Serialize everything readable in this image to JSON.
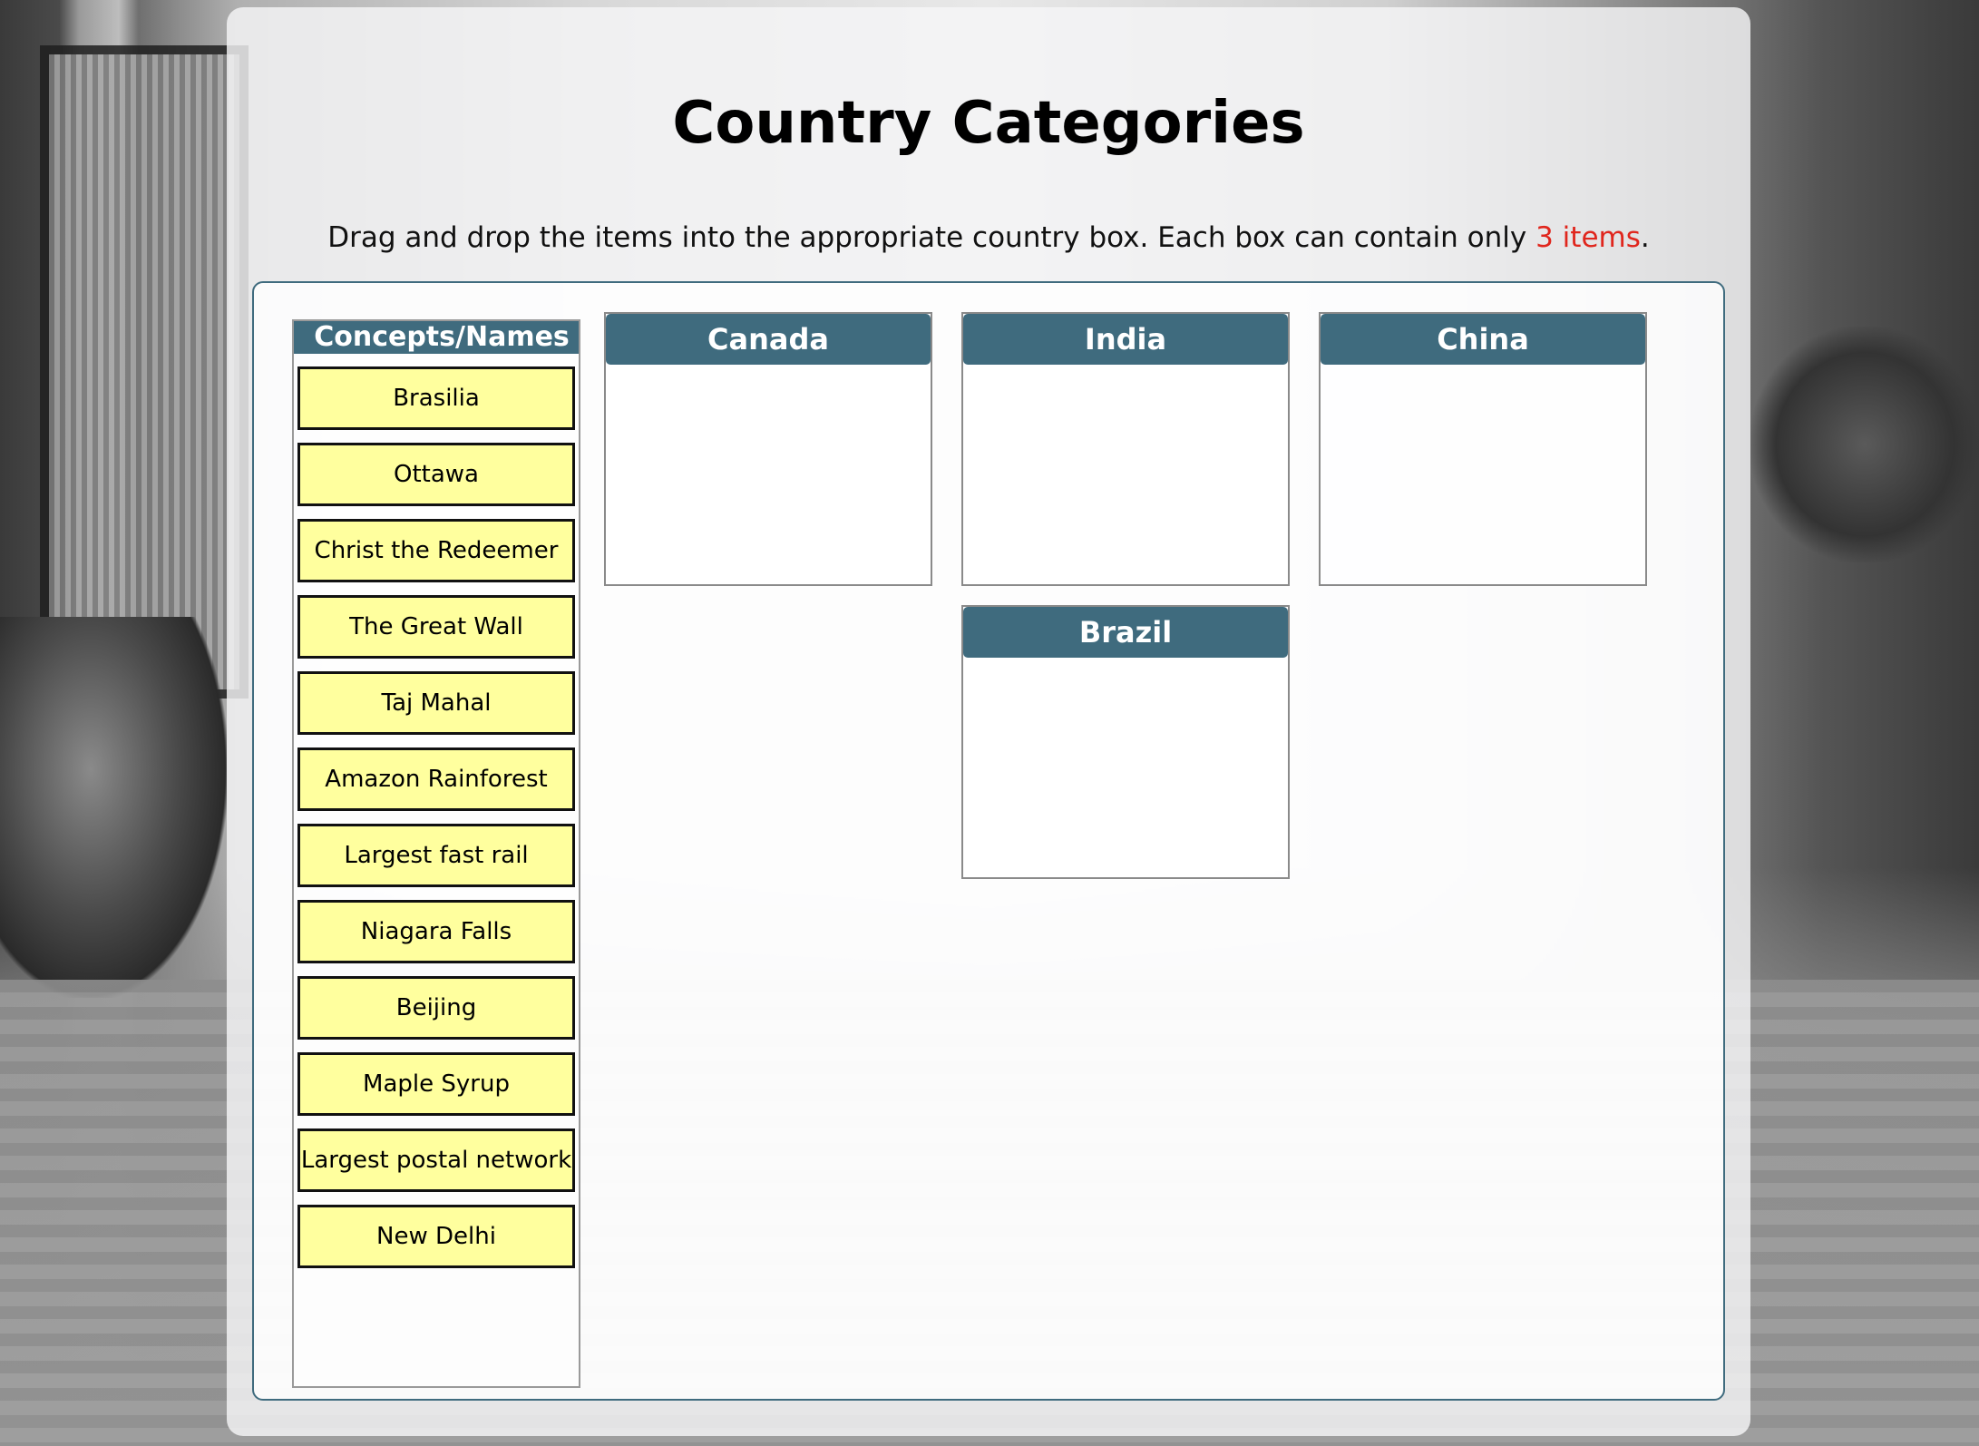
{
  "page": {
    "title": "Country Categories",
    "instructions_prefix": "Drag and drop the items into the appropriate country box. Each box can contain only ",
    "instructions_limit": "3 items",
    "instructions_suffix": "."
  },
  "source": {
    "header": "Concepts/Names",
    "items": [
      "Brasilia",
      "Ottawa",
      "Christ the Redeemer",
      "The Great Wall",
      "Taj Mahal",
      "Amazon Rainforest",
      "Largest fast rail",
      "Niagara Falls",
      "Beijing",
      "Maple Syrup",
      "Largest postal network",
      "New Delhi"
    ]
  },
  "countries": [
    "Canada",
    "India",
    "China",
    "Brazil"
  ],
  "colors": {
    "header_bg": "#3f6b7e",
    "item_bg": "#ffff9e",
    "limit_text": "#e0261d"
  }
}
